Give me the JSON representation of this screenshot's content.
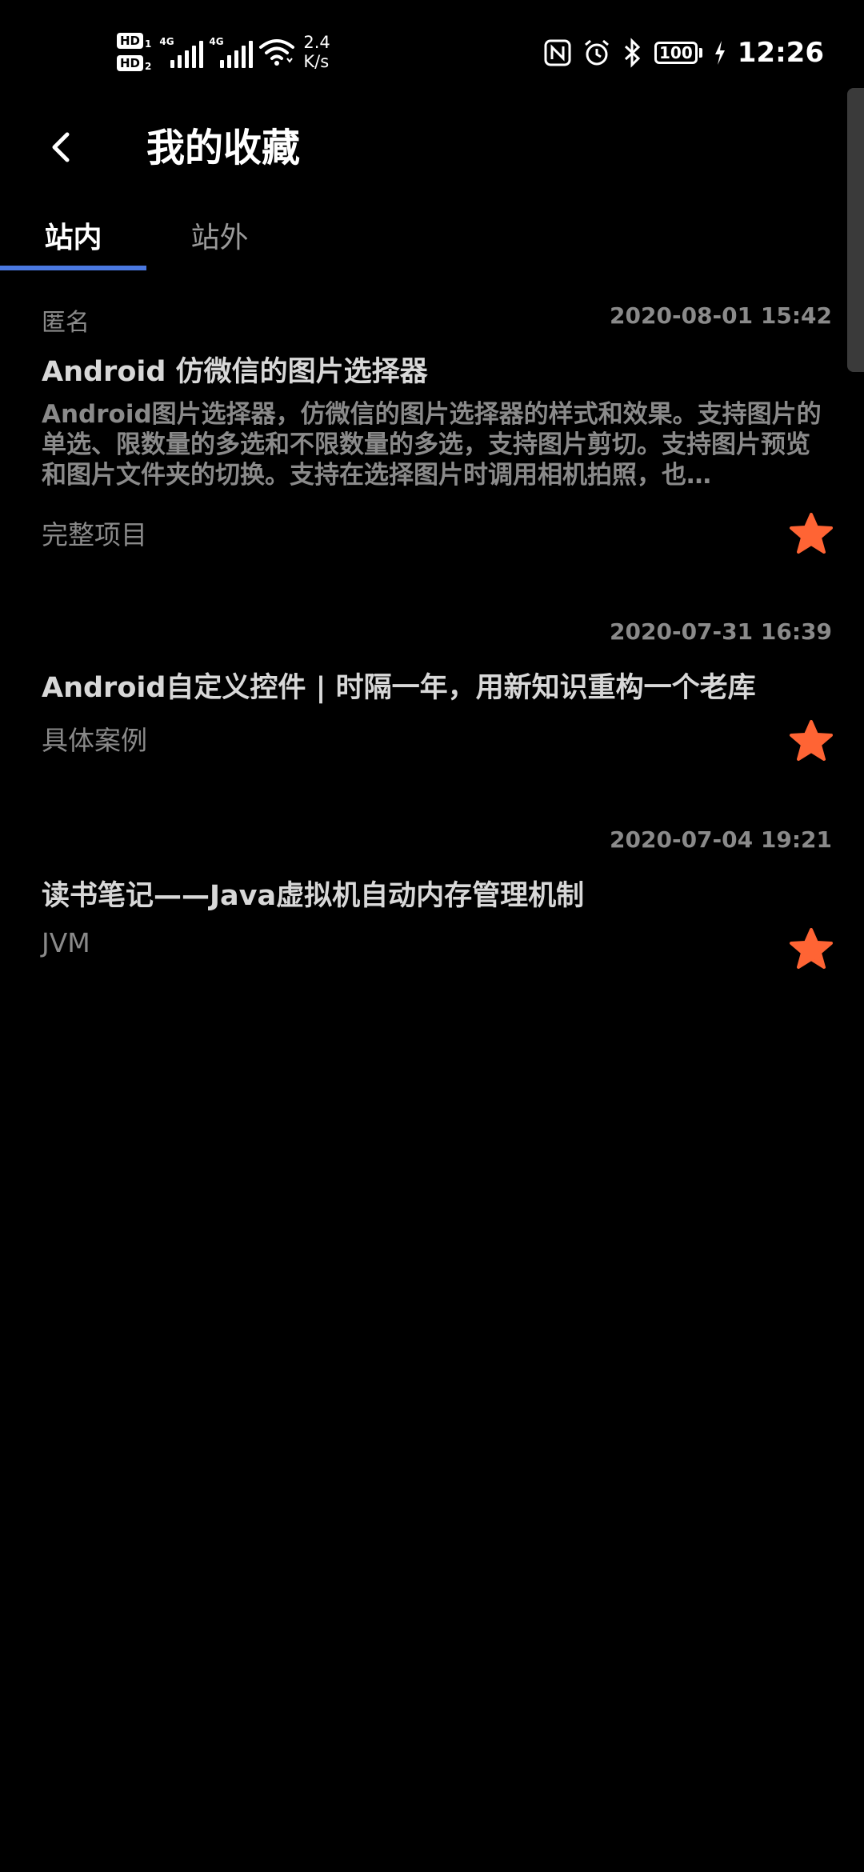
{
  "status_bar": {
    "hd1": "HD",
    "hd1_sub": "1",
    "hd2": "HD",
    "hd2_sub": "2",
    "net1": "4G",
    "net2": "4G",
    "speed_value": "2.4",
    "speed_unit": "K/s",
    "battery": "100",
    "time": "12:26",
    "icons": [
      "nfc-icon",
      "alarm-icon",
      "bluetooth-icon",
      "battery-icon",
      "charging-icon"
    ]
  },
  "header": {
    "title": "我的收藏"
  },
  "tabs": [
    {
      "label": "站内",
      "active": true
    },
    {
      "label": "站外",
      "active": false
    }
  ],
  "accent_color": "#4a78e0",
  "star_color": "#ff6434",
  "items": [
    {
      "author": "匿名",
      "date": "2020-08-01 15:42",
      "title": "Android 仿微信的图片选择器",
      "desc": "Android图片选择器，仿微信的图片选择器的样式和效果。支持图片的单选、限数量的多选和不限数量的多选，支持图片剪切。支持图片预览和图片文件夹的切换。支持在选择图片时调用相机拍照，也…",
      "chapter": "完整项目"
    },
    {
      "author": "",
      "date": "2020-07-31 16:39",
      "title": "Android自定义控件 | 时隔一年，用新知识重构一个老库",
      "desc": "",
      "chapter": "具体案例"
    },
    {
      "author": "",
      "date": "2020-07-04 19:21",
      "title": "读书笔记——Java虚拟机自动内存管理机制",
      "desc": "",
      "chapter": "JVM"
    }
  ]
}
